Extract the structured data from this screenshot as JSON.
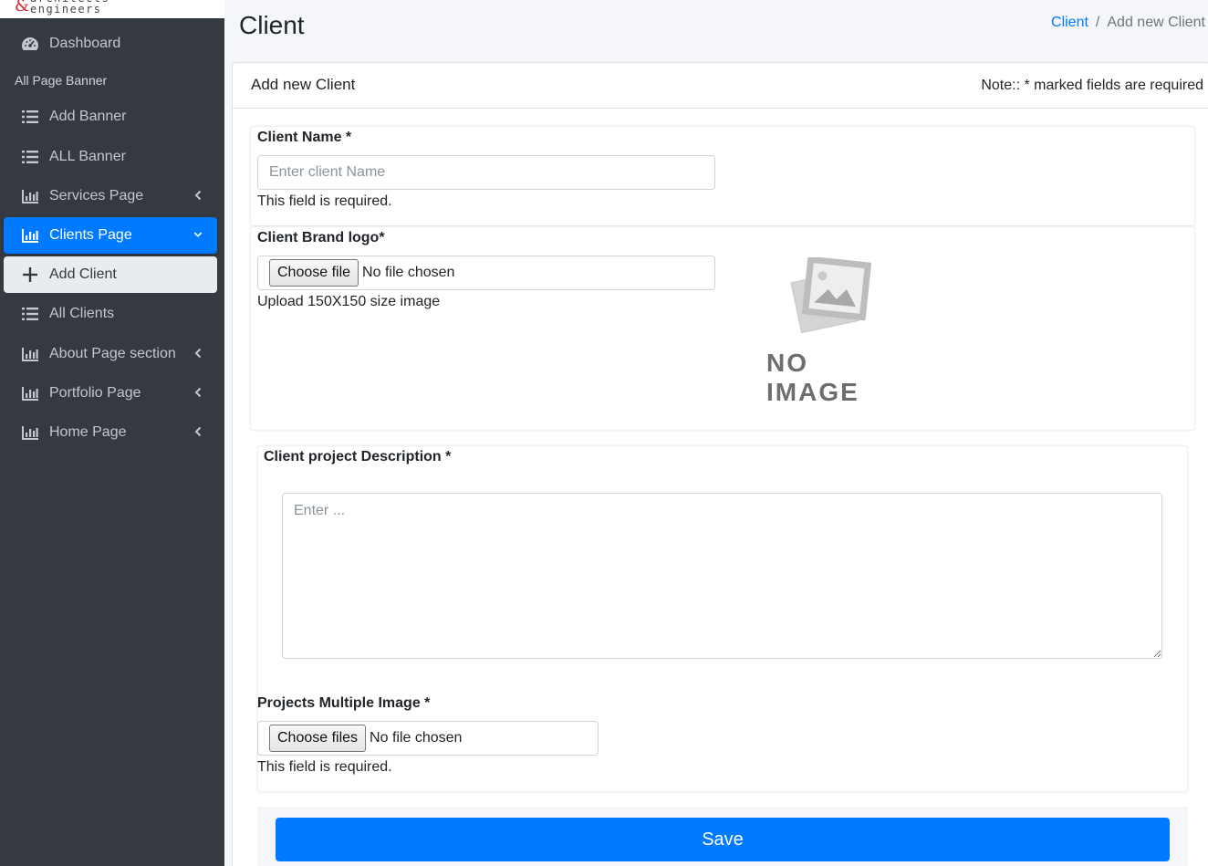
{
  "sidebar": {
    "brand": {
      "amp": "&",
      "word_top": "architects",
      "word": "engineers"
    },
    "header": "All Page Banner",
    "items": [
      {
        "label": "Dashboard"
      },
      {
        "label": "Add Banner"
      },
      {
        "label": "ALL Banner"
      },
      {
        "label": "Services Page"
      },
      {
        "label": "Clients Page"
      },
      {
        "label": "Add Client"
      },
      {
        "label": "All Clients"
      },
      {
        "label": "About Page section"
      },
      {
        "label": "Portfolio Page"
      },
      {
        "label": "Home Page"
      }
    ]
  },
  "page": {
    "title": "Client",
    "breadcrumb": {
      "link": "Client",
      "separator": "/",
      "current": "Add new Client"
    }
  },
  "card": {
    "title": "Add new Client",
    "note": "Note:: * marked fields are required"
  },
  "form": {
    "client_name": {
      "label": "Client Name *",
      "placeholder": "Enter client Name",
      "value": "",
      "help": "This field is required."
    },
    "brand_logo": {
      "label": "Client Brand logo*",
      "button": "Choose file",
      "status": "No file chosen",
      "help": "Upload 150X150 size image",
      "preview_text": "NO IMAGE"
    },
    "description": {
      "label": "Client project Description *",
      "placeholder": "Enter ...",
      "value": ""
    },
    "multiple_image": {
      "label": "Projects Multiple Image *",
      "button": "Choose files",
      "status": "No file chosen",
      "help": "This field is required."
    },
    "save": "Save"
  },
  "colors": {
    "sidebar_bg": "#343a40",
    "accent": "#007bff",
    "content_bg": "#f4f6f9"
  }
}
